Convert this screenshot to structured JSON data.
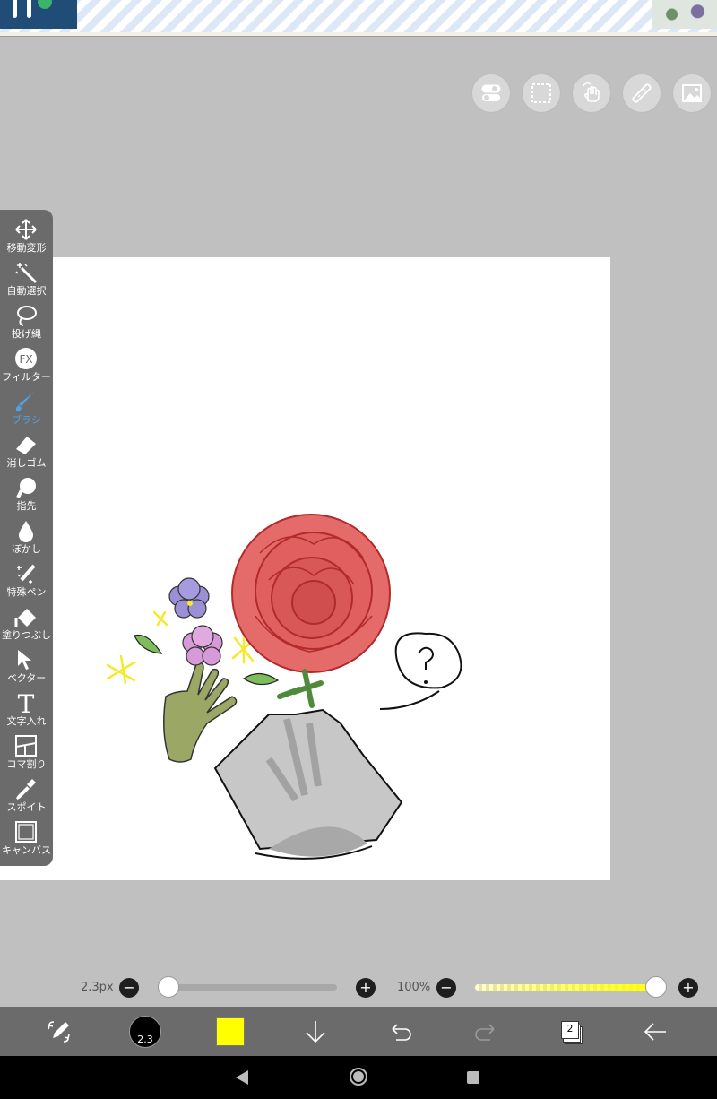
{
  "ad": {
    "logo": "",
    "thumbnail": ""
  },
  "top_tools": [
    {
      "name": "toggle-icon"
    },
    {
      "name": "selection-icon"
    },
    {
      "name": "hand-icon"
    },
    {
      "name": "ruler-icon"
    },
    {
      "name": "image-icon"
    }
  ],
  "left_toolbar": {
    "items": [
      {
        "icon": "move-icon",
        "label": "移動変形"
      },
      {
        "icon": "magic-wand-icon",
        "label": "自動選択"
      },
      {
        "icon": "lasso-icon",
        "label": "投げ縄"
      },
      {
        "icon": "fx-icon",
        "label": "フィルター",
        "icon_text": "FX"
      },
      {
        "icon": "brush-icon",
        "label": "ブラシ",
        "active": true
      },
      {
        "icon": "eraser-icon",
        "label": "消しゴム"
      },
      {
        "icon": "finger-icon",
        "label": "指先"
      },
      {
        "icon": "drop-icon",
        "label": "ぼかし"
      },
      {
        "icon": "special-pen-icon",
        "label": "特殊ペン"
      },
      {
        "icon": "fill-icon",
        "label": "塗りつぶし"
      },
      {
        "icon": "vector-icon",
        "label": "ベクター"
      },
      {
        "icon": "text-icon",
        "label": "文字入れ",
        "icon_text": "T"
      },
      {
        "icon": "panel-icon",
        "label": "コマ割り"
      },
      {
        "icon": "eyedropper-icon",
        "label": "スポイト"
      },
      {
        "icon": "canvas-icon",
        "label": "キャンバス"
      }
    ],
    "active_color": "#4ea3e6"
  },
  "sliders": {
    "brush_size_label": "2.3px",
    "brush_size_fraction": 0.05,
    "opacity_label": "100%",
    "opacity_fraction": 1.0,
    "minus": "−",
    "plus": "+"
  },
  "bottom_toolbar": {
    "brush_size": "2.3",
    "current_color": "#ffff00",
    "layer_count": "2"
  },
  "colors": {
    "toolbar_bg": "#6b6b6b",
    "workspace_bg": "#c0c0c0",
    "accent": "#4ea3e6"
  }
}
